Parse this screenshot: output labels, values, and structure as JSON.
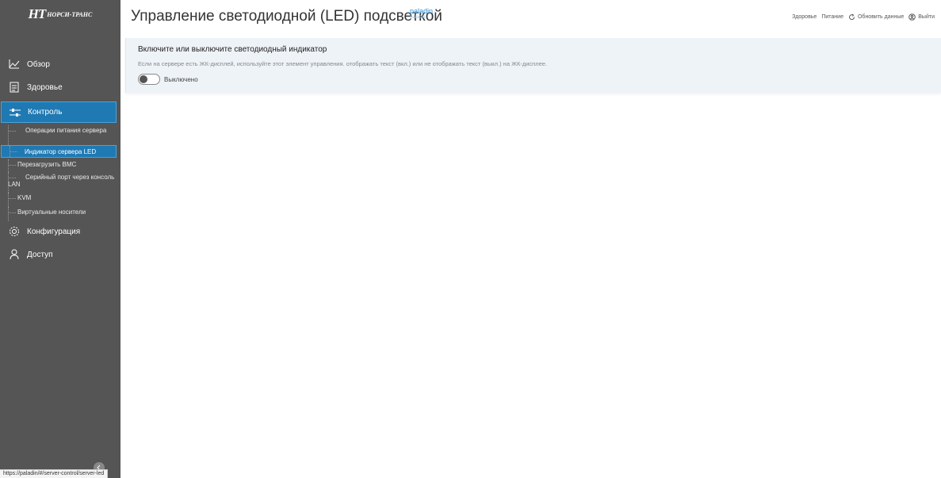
{
  "brand": {
    "mark": "НТ",
    "name": "НОРСИ-ТРАНС"
  },
  "header": {
    "title": "Управление светодиодной (LED) подсветкой",
    "host": "paladin",
    "host_sub": "paladin",
    "links": {
      "health": "Здоровье",
      "power": "Питание",
      "refresh": "Обновить данные",
      "logout": "Выйти"
    }
  },
  "sidebar": {
    "items": [
      {
        "label": "Обзор",
        "icon": "chart-line-icon"
      },
      {
        "label": "Здоровье",
        "icon": "clipboard-icon"
      },
      {
        "label": "Контроль",
        "icon": "sliders-icon"
      },
      {
        "label": "Конфигурация",
        "icon": "gear-icon"
      },
      {
        "label": "Доступ",
        "icon": "user-icon"
      }
    ],
    "subitems": [
      {
        "label": "Операции питания сервера"
      },
      {
        "label": "Индикатор сервера LED"
      },
      {
        "label": "Перезагрузить BMC"
      },
      {
        "label": "Серийный порт через консоль LAN"
      },
      {
        "label": "KVM"
      },
      {
        "label": "Виртуальные носители"
      }
    ]
  },
  "card": {
    "title": "Включите или выключите светодиодный индикатор",
    "description": "Если на сервере есть ЖК-дисплей, используйте этот элемент управления. отображать текст (вкл.) или не отображать текст (выкл.) на ЖК-дисплее.",
    "toggle_state": "Выключено"
  },
  "status_url": "https://paladin/#/server-control/server-led",
  "colors": {
    "sidebar": "#555555",
    "active": "#1f79b3",
    "accent": "#2a8fd6"
  }
}
